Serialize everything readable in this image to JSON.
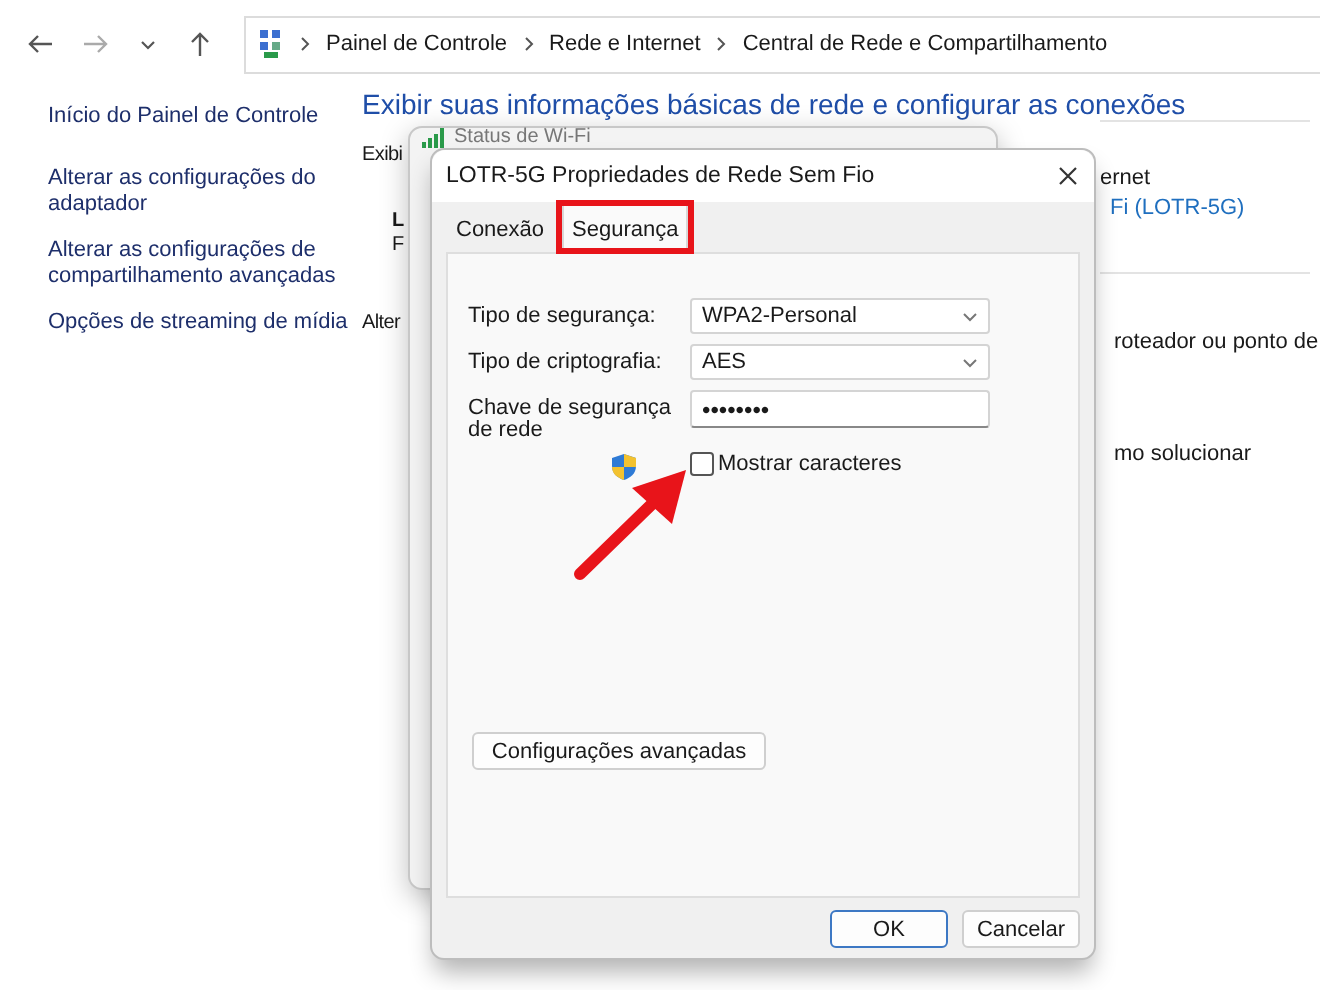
{
  "breadcrumb": [
    "Painel de Controle",
    "Rede e Internet",
    "Central de Rede e Compartilhamento"
  ],
  "sidebar": {
    "items": [
      "Início do Painel de Controle",
      "Alterar as configurações do adaptador",
      "Alterar as configurações de compartilhamento avançadas",
      "Opções de streaming de mídia"
    ]
  },
  "main": {
    "heading": "Exibir suas informações básicas de rede e configurar as conexões",
    "left_fragments": [
      {
        "kind": "label",
        "text": "Exibi"
      },
      {
        "kind": "bold",
        "text": "L"
      },
      {
        "kind": "plain",
        "text": "F"
      },
      {
        "kind": "label",
        "text": "Alter"
      }
    ],
    "right_fragments": [
      {
        "kind": "plain",
        "text": "ernet"
      },
      {
        "kind": "link",
        "text": "Fi (LOTR-5G)"
      },
      {
        "kind": "plain",
        "text": "roteador ou ponto de"
      },
      {
        "kind": "plain",
        "text": "mo solucionar"
      }
    ]
  },
  "status_window": {
    "title": "Status de Wi-Fi"
  },
  "dialog": {
    "title": "LOTR-5G Propriedades de Rede Sem Fio",
    "tabs": [
      {
        "label": "Conexão",
        "selected": false,
        "highlighted": false
      },
      {
        "label": "Segurança",
        "selected": true,
        "highlighted": true
      }
    ],
    "fields": [
      {
        "kind": "select",
        "label": "Tipo de segurança:",
        "value": "WPA2-Personal"
      },
      {
        "kind": "select",
        "label": "Tipo de criptografia:",
        "value": "AES"
      },
      {
        "kind": "password",
        "label": "Chave de segurança de rede",
        "value": "••••••••"
      }
    ],
    "show_characters": {
      "label": "Mostrar caracteres",
      "checked": false,
      "arrow_pointer": true
    },
    "advanced_button": "Configurações avançadas",
    "buttons": [
      {
        "label": "OK",
        "default": true
      },
      {
        "label": "Cancelar",
        "default": false
      }
    ]
  }
}
